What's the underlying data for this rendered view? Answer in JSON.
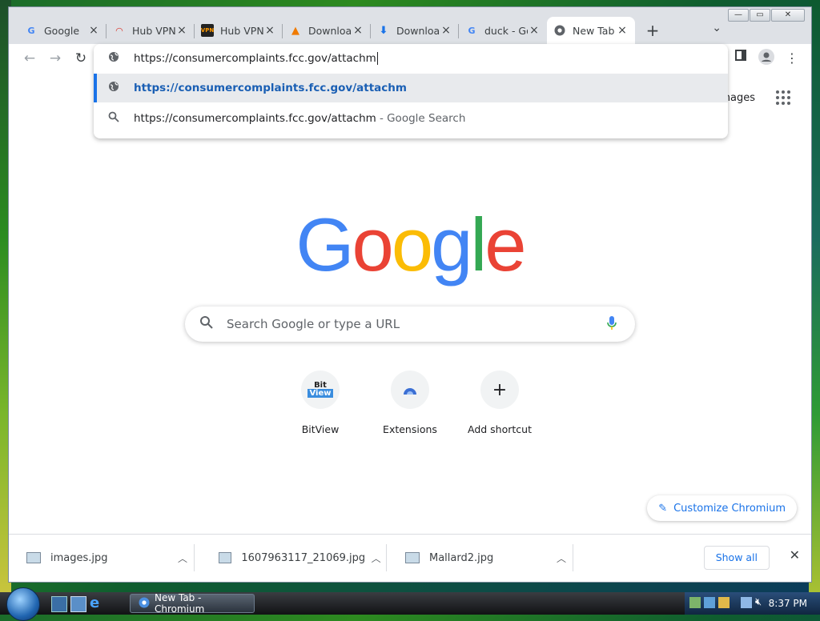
{
  "window": {
    "controls": [
      "—",
      "▭",
      "✕"
    ]
  },
  "tabs": [
    {
      "title": "Google",
      "favicon": "google-icon",
      "active": false
    },
    {
      "title": "Hub VPN",
      "favicon": "hubvpn-icon",
      "active": false
    },
    {
      "title": "Hub VPN",
      "favicon": "vpnhub-icon",
      "active": false
    },
    {
      "title": "Download",
      "favicon": "vlc-icon",
      "active": false
    },
    {
      "title": "Download",
      "favicon": "download-icon",
      "active": false
    },
    {
      "title": "duck - Go",
      "favicon": "google-icon",
      "active": false
    },
    {
      "title": "New Tab",
      "favicon": "chromium-icon",
      "active": true
    }
  ],
  "omnibox": {
    "input_text": "https://consumercomplaints.fcc.gov/attachm",
    "suggestions": [
      {
        "text": "https://consumercomplaints.fcc.gov/attachm",
        "icon": "globe-icon"
      },
      {
        "text": "https://consumercomplaints.fcc.gov/attachm",
        "suffix": "- Google Search",
        "icon": "search-icon"
      }
    ]
  },
  "page": {
    "images_link": "Images",
    "logo": [
      "G",
      "o",
      "o",
      "g",
      "l",
      "e"
    ],
    "logo_colors": [
      "#4285F4",
      "#EA4335",
      "#FBBC05",
      "#4285F4",
      "#34A853",
      "#EA4335"
    ],
    "search_placeholder": "Search Google or type a URL",
    "shortcuts": [
      {
        "label": "BitView",
        "icon": "bitview-icon"
      },
      {
        "label": "Extensions",
        "icon": "extensions-icon"
      },
      {
        "label": "Add shortcut",
        "icon": "plus-icon"
      }
    ],
    "customize_label": "Customize Chromium"
  },
  "downloads": {
    "items": [
      "images.jpg",
      "1607963117_21069.jpg",
      "Mallard2.jpg"
    ],
    "show_all": "Show all"
  },
  "taskbar": {
    "active_task": "New Tab - Chromium",
    "clock": "8:37 PM"
  },
  "colors": {
    "accent": "#1a73e8",
    "suggestion_highlight": "#e8eaed"
  }
}
